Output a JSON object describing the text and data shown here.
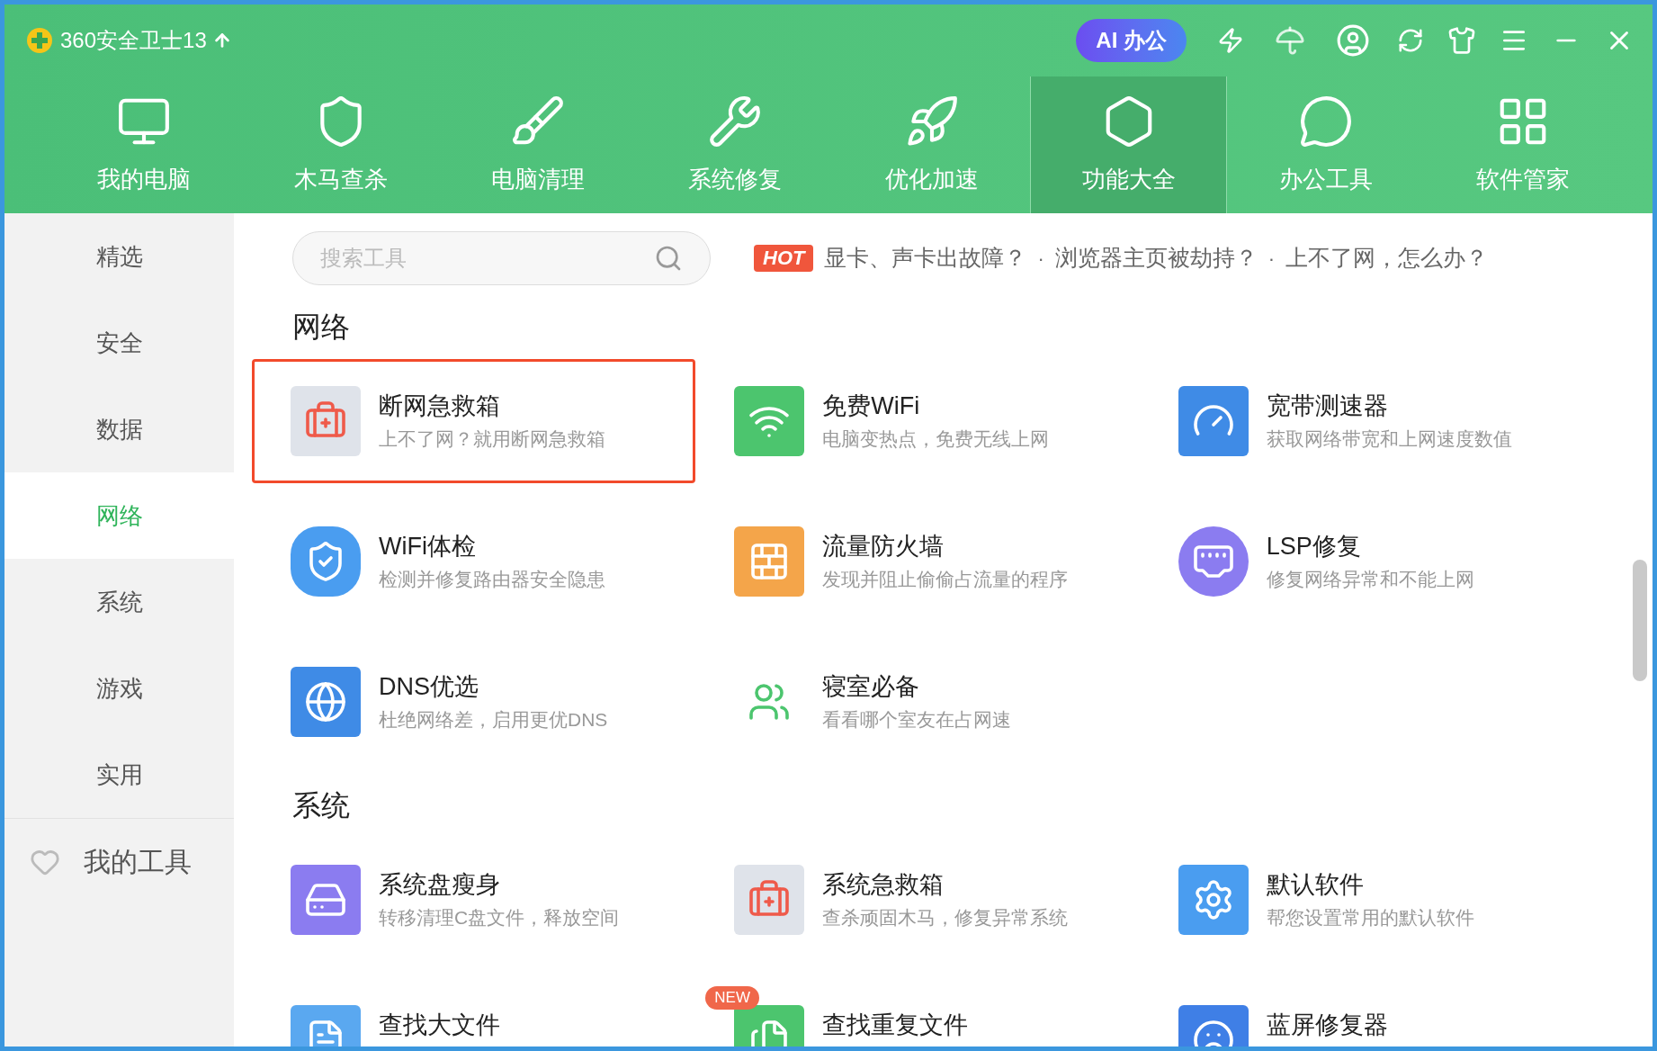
{
  "window": {
    "title": "360安全卫士13"
  },
  "title_bar": {
    "ai_button": "AI 办公"
  },
  "nav": [
    {
      "label": "我的电脑",
      "selected": false
    },
    {
      "label": "木马查杀",
      "selected": false
    },
    {
      "label": "电脑清理",
      "selected": false
    },
    {
      "label": "系统修复",
      "selected": false
    },
    {
      "label": "优化加速",
      "selected": false
    },
    {
      "label": "功能大全",
      "selected": true
    },
    {
      "label": "办公工具",
      "selected": false
    },
    {
      "label": "软件管家",
      "selected": false
    }
  ],
  "sidebar": {
    "items": [
      {
        "label": "精选",
        "selected": false
      },
      {
        "label": "安全",
        "selected": false
      },
      {
        "label": "数据",
        "selected": false
      },
      {
        "label": "网络",
        "selected": true
      },
      {
        "label": "系统",
        "selected": false
      },
      {
        "label": "游戏",
        "selected": false
      },
      {
        "label": "实用",
        "selected": false
      }
    ],
    "my_tools": "我的工具"
  },
  "search": {
    "placeholder": "搜索工具"
  },
  "hot": {
    "badge": "HOT",
    "separator": "·",
    "links": [
      "显卡、声卡出故障？",
      "浏览器主页被劫持？",
      "上不了网，怎么办？"
    ]
  },
  "sections": [
    {
      "title": "网络",
      "tools": [
        {
          "name": "断网急救箱",
          "desc": "上不了网？就用断网急救箱",
          "highlighted": true
        },
        {
          "name": "免费WiFi",
          "desc": "电脑变热点，免费无线上网",
          "highlighted": false
        },
        {
          "name": "宽带测速器",
          "desc": "获取网络带宽和上网速度数值",
          "highlighted": false
        },
        {
          "name": "WiFi体检",
          "desc": "检测并修复路由器安全隐患",
          "highlighted": false
        },
        {
          "name": "流量防火墙",
          "desc": "发现并阻止偷偷占流量的程序",
          "highlighted": false
        },
        {
          "name": "LSP修复",
          "desc": "修复网络异常和不能上网",
          "highlighted": false
        },
        {
          "name": "DNS优选",
          "desc": "杜绝网络差，启用更优DNS",
          "highlighted": false
        },
        {
          "name": "寝室必备",
          "desc": "看看哪个室友在占网速",
          "highlighted": false
        }
      ]
    },
    {
      "title": "系统",
      "tools": [
        {
          "name": "系统盘瘦身",
          "desc": "转移清理C盘文件，释放空间",
          "highlighted": false
        },
        {
          "name": "系统急救箱",
          "desc": "查杀顽固木马，修复异常系统",
          "highlighted": false
        },
        {
          "name": "默认软件",
          "desc": "帮您设置常用的默认软件",
          "highlighted": false
        },
        {
          "name": "查找大文件",
          "highlighted": false
        },
        {
          "name": "查找重复文件",
          "highlighted": false,
          "badge": "NEW"
        },
        {
          "name": "蓝屏修复器",
          "highlighted": false
        }
      ]
    }
  ]
}
